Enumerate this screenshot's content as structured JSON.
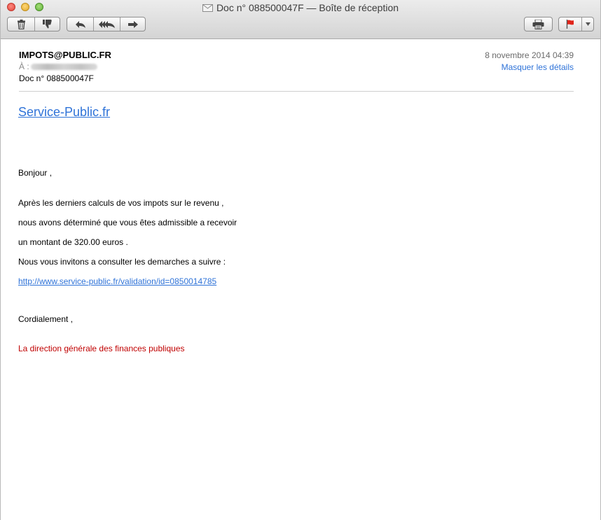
{
  "window": {
    "title": "Doc n° 088500047F — Boîte de réception"
  },
  "toolbar": {
    "delete": "trash-icon",
    "junk": "thumbs-down-icon",
    "reply": "reply-arrow-icon",
    "reply_all": "reply-all-arrow-icon",
    "forward": "forward-arrow-icon",
    "print": "printer-icon",
    "flag": "red-flag-icon",
    "flag_menu": "chevron-down-icon"
  },
  "header": {
    "from": "IMPOTS@PUBLIC.FR",
    "to_label": "À :",
    "subject": "Doc n° 088500047F",
    "date": "8 novembre 2014 04:39",
    "hide_details": "Masquer les détails"
  },
  "body": {
    "brand_link": "Service-Public.fr",
    "greeting": "Bonjour ,",
    "p1": "Après les derniers calculs de vos impots sur le revenu ,",
    "p2": "nous avons déterminé que vous êtes admissible a recevoir",
    "p3": "un montant de 320.00 euros .",
    "p4": "Nous vous invitons a consulter les demarches a suivre :",
    "link": "http://www.service-public.fr/validation/id=0850014785",
    "closing": "Cordialement ,",
    "signature": "La direction générale des finances publiques"
  },
  "colors": {
    "link": "#2f73d8",
    "signature": "#c00000"
  }
}
